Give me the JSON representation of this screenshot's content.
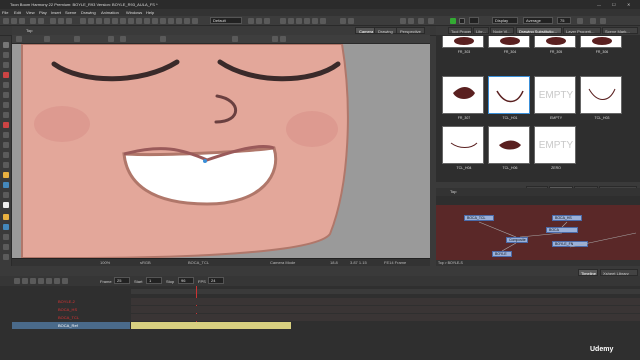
{
  "window": {
    "title": "Toon Boom Harmony 22 Premium: BOYLE_R93 Version: BOYLE_R93_AULA_FS *",
    "controls": [
      "—",
      "☐",
      "✕"
    ]
  },
  "menu": [
    "File",
    "Edit",
    "View",
    "Play",
    "Insert",
    "Scene",
    "Drawing",
    "Animation",
    "Windows",
    "Help"
  ],
  "toolbar": {
    "workspace_dropdown": "Default",
    "display_dropdown": "Display",
    "average_dropdown": "Average",
    "percent": "75"
  },
  "view_tabs": [
    {
      "label": "Camera",
      "active": true
    },
    {
      "label": "Drawing",
      "active": false
    },
    {
      "label": "Perspective",
      "active": false
    }
  ],
  "view_title": "Top",
  "viewport_status": {
    "zoom": "100%",
    "mode": "sRGB",
    "layer": "BOCA_TCL",
    "hint": "Camera Mode",
    "fields": "18.8",
    "coords": "3.87 1.15",
    "frame": "FE14 Frame"
  },
  "right_tabs": [
    {
      "label": "Tool Properties",
      "active": false
    },
    {
      "label": "Libr...",
      "active": false
    },
    {
      "label": "Node Vi...",
      "active": false
    },
    {
      "label": "Drawing Substitutio...",
      "active": true
    },
    {
      "label": "Layer Properti...",
      "active": false
    },
    {
      "label": "Scene Mark...",
      "active": false
    }
  ],
  "substitutions": [
    {
      "label": "FR_303",
      "shape": "mouth-open"
    },
    {
      "label": "FR_304",
      "shape": "mouth-open"
    },
    {
      "label": "FR_305",
      "shape": "mouth-open"
    },
    {
      "label": "FR_306",
      "shape": "mouth-open"
    },
    {
      "label": "FR_307",
      "shape": "mouth-blob"
    },
    {
      "label": "TCL_H01",
      "shape": "smile-line",
      "selected": true
    },
    {
      "label": "EMPTY",
      "shape": "empty"
    },
    {
      "label": "TCL_H03",
      "shape": "smile-thin"
    },
    {
      "label": "TCL_H04",
      "shape": "smile-thin"
    },
    {
      "label": "TCL_H06",
      "shape": "mouth-blob"
    },
    {
      "label": "ZERO",
      "shape": "empty"
    }
  ],
  "empty_label": "EMPTY",
  "node_view": {
    "tabs": [
      {
        "label": "Colour",
        "active": false
      },
      {
        "label": "Node View",
        "active": true
      },
      {
        "label": "Onion Skin",
        "active": false
      },
      {
        "label": "Reference View",
        "active": false
      }
    ],
    "title": "Top",
    "nodes": [
      "BOCA_TCL",
      "BOCA_HS",
      "BOCA",
      "Composite",
      "BOYLE_FN",
      "BOYLE"
    ],
    "footer": "Top > BOYLE-S"
  },
  "timeline": {
    "tabs": [
      "Timeline",
      "Xsheet Library"
    ],
    "frame_label": "Frame",
    "frame_value": "25",
    "start_label": "Start",
    "start_value": "1",
    "stop_label": "Stop",
    "stop_value": "96",
    "fps_label": "FPS",
    "fps_value": "24",
    "layers": [
      {
        "name": "BOYLE-2",
        "color": "#c0392b"
      },
      {
        "name": "BOCA_HS",
        "color": "#c0392b"
      },
      {
        "name": "BOCA_TCL",
        "color": "#d8c870"
      },
      {
        "name": "BOCA_Ref",
        "color": "#ddd"
      }
    ]
  },
  "watermark": "Udemy",
  "accent": "#3a8fd8",
  "skin": "#e3a79a"
}
